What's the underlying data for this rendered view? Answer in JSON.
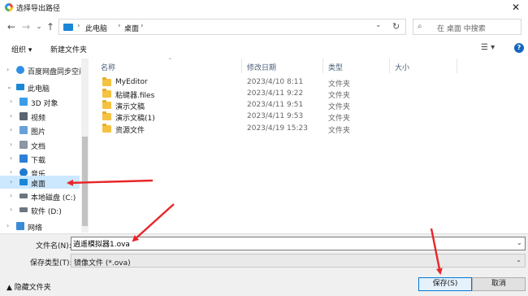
{
  "window": {
    "title": "选择导出路径",
    "close_glyph": "✕"
  },
  "nav": {
    "back_glyph": "←",
    "forward_glyph": "→",
    "recent_glyph": "⌄",
    "up_glyph": "↑",
    "breadcrumbs": [
      "此电脑",
      "桌面"
    ],
    "sep_glyph": "›",
    "dropdown_glyph": "⌄",
    "refresh_glyph": "↻",
    "search_placeholder": "在 桌面 中搜索",
    "search_glyph": "⌕"
  },
  "toolbar": {
    "organize_label": "组织 ▾",
    "new_folder_label": "新建文件夹",
    "view_glyph": "☰ ▾",
    "help_glyph": "?"
  },
  "sidebar": {
    "items": [
      {
        "label": "百度网盘同步空间",
        "icon_color": "#2f8fe8",
        "exp": "›",
        "selected": false
      },
      {
        "label": "此电脑",
        "icon_color": "#1c86d6",
        "exp": "⌄",
        "selected": false
      },
      {
        "label": "3D 对象",
        "icon_color": "#3b9de8",
        "exp": "›",
        "selected": false
      },
      {
        "label": "视频",
        "icon_color": "#5b6470",
        "exp": "›",
        "selected": false
      },
      {
        "label": "图片",
        "icon_color": "#6aa0d8",
        "exp": "›",
        "selected": false
      },
      {
        "label": "文档",
        "icon_color": "#8b96a6",
        "exp": "›",
        "selected": false
      },
      {
        "label": "下载",
        "icon_color": "#2d7fd6",
        "exp": "›",
        "selected": false
      },
      {
        "label": "音乐",
        "icon_color": "#1f7ad0",
        "exp": "›",
        "selected": false
      },
      {
        "label": "桌面",
        "icon_color": "#1c86d6",
        "exp": "›",
        "selected": true
      },
      {
        "label": "本地磁盘 (C:)",
        "icon_color": "#6c7681",
        "exp": "›",
        "selected": false
      },
      {
        "label": "软件 (D:)",
        "icon_color": "#6c7681",
        "exp": "›",
        "selected": false
      },
      {
        "label": "网络",
        "icon_color": "#3a8ad8",
        "exp": "›",
        "selected": false
      }
    ]
  },
  "columns": {
    "name": "名称",
    "date": "修改日期",
    "type": "类型",
    "size": "大小",
    "sort_glyph": "^"
  },
  "files": [
    {
      "name": "MyEditor",
      "date": "2023/4/10 8:11",
      "type": "文件夹"
    },
    {
      "name": "粘键器.files",
      "date": "2023/4/11 9:22",
      "type": "文件夹"
    },
    {
      "name": "演示文稿",
      "date": "2023/4/11 9:51",
      "type": "文件夹"
    },
    {
      "name": "演示文稿(1)",
      "date": "2023/4/11 9:53",
      "type": "文件夹"
    },
    {
      "name": "资源文件",
      "date": "2023/4/19 15:23",
      "type": "文件夹"
    }
  ],
  "form": {
    "filename_label": "文件名(N):",
    "filename_value": "逍遥模拟器1.ova",
    "filename_dd_glyph": "⌄",
    "filetype_label": "保存类型(T):",
    "filetype_value": "镜像文件 (*.ova)",
    "filetype_dd_glyph": "⌄",
    "hide_folders_label": "▲ 隐藏文件夹",
    "save_label": "保存(S)",
    "cancel_label": "取消"
  },
  "colors": {
    "annotation_arrow": "#e8262a",
    "selection": "#cce8ff",
    "folder": "#f5c242",
    "accent": "#0078d7"
  }
}
